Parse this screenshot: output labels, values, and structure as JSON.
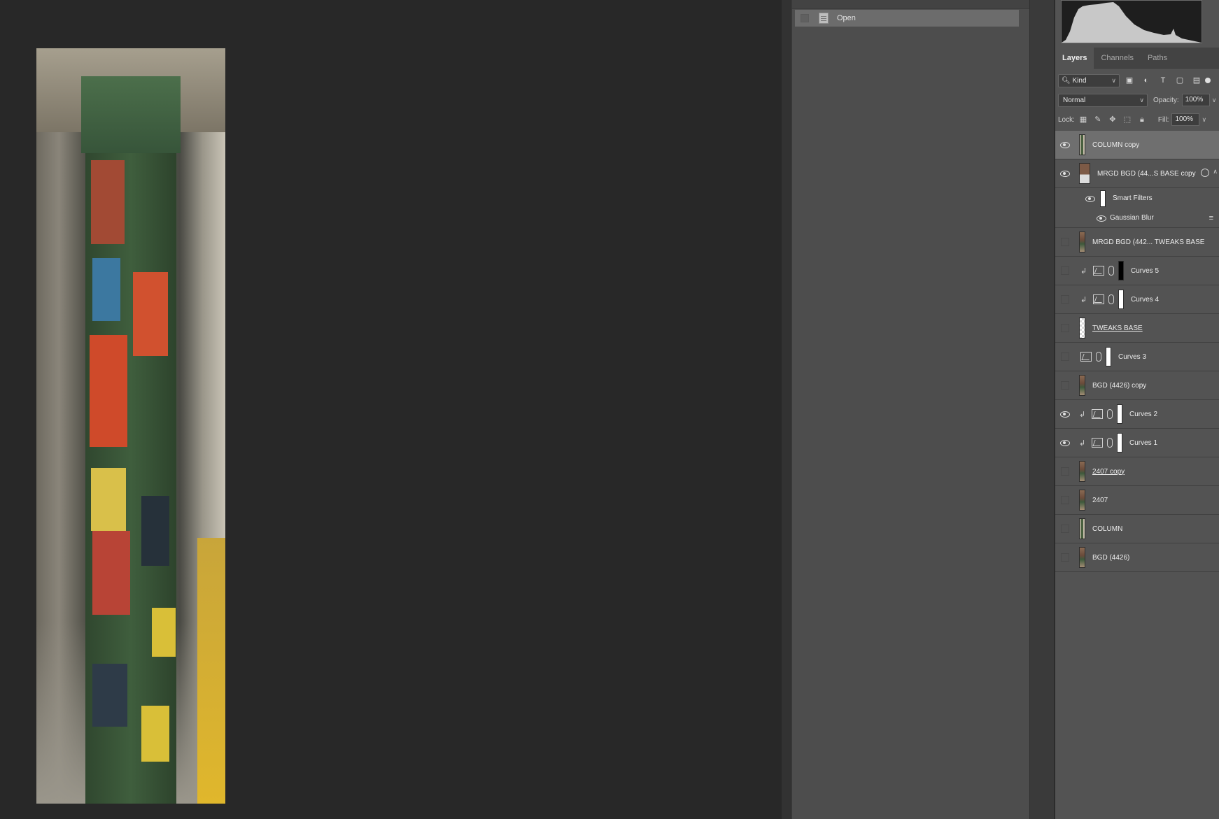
{
  "history": {
    "items": [
      {
        "label": "Open"
      }
    ]
  },
  "layers_panel": {
    "tabs": [
      {
        "label": "Layers"
      },
      {
        "label": "Channels"
      },
      {
        "label": "Paths"
      }
    ],
    "filter": {
      "kind_label": "Kind"
    },
    "blend_mode": "Normal",
    "opacity_label": "Opacity:",
    "opacity_value": "100%",
    "lock_label": "Lock:",
    "fill_label": "Fill:",
    "fill_value": "100%",
    "layers": [
      {
        "name": "COLUMN copy",
        "visible": true,
        "selected": true
      },
      {
        "name": "MRGD BGD (44...S BASE copy",
        "visible": true,
        "smart_object": true
      },
      {
        "name": "Smart Filters",
        "visible": true
      },
      {
        "name": "Gaussian Blur",
        "visible": true
      },
      {
        "name": "MRGD BGD (442... TWEAKS BASE",
        "visible": false
      },
      {
        "name": "Curves 5",
        "visible": false,
        "clipped": true
      },
      {
        "name": "Curves 4",
        "visible": false,
        "clipped": true
      },
      {
        "name": "TWEAKS BASE",
        "visible": false
      },
      {
        "name": "Curves 3",
        "visible": false
      },
      {
        "name": "BGD (4426) copy",
        "visible": false
      },
      {
        "name": "Curves 2",
        "visible": true,
        "clipped": true
      },
      {
        "name": "Curves 1",
        "visible": true,
        "clipped": true
      },
      {
        "name": "2407 copy",
        "visible": false
      },
      {
        "name": "2407",
        "visible": false
      },
      {
        "name": "COLUMN",
        "visible": false
      },
      {
        "name": "BGD (4426)",
        "visible": false
      }
    ]
  }
}
